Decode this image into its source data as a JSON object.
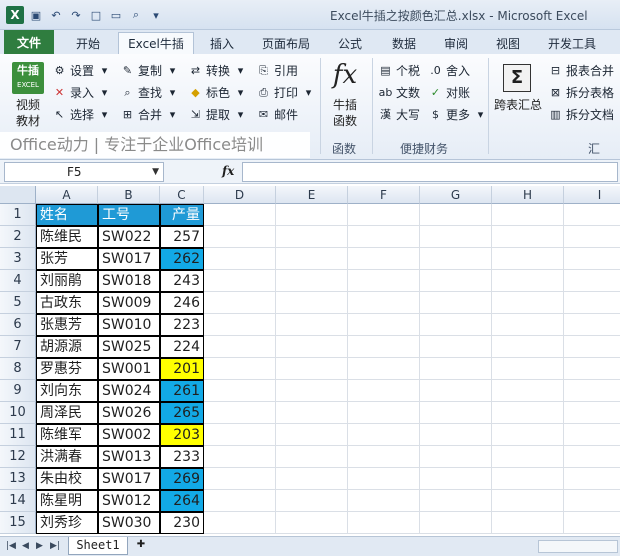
{
  "window": {
    "title": "Excel牛插之按颜色汇总.xlsx - Microsoft Excel",
    "app_icon": "X"
  },
  "qat": {
    "icons": [
      "save-icon",
      "undo-icon",
      "redo-icon",
      "new-icon",
      "open-icon",
      "print-preview-icon",
      "customize-icon"
    ]
  },
  "tabs": [
    "文件",
    "开始",
    "Excel牛插",
    "插入",
    "页面布局",
    "公式",
    "数据",
    "审阅",
    "视图",
    "开发工具"
  ],
  "ribbon": {
    "logo": {
      "line1": "牛插",
      "line2": "EXCEL"
    },
    "video_label_1": "视频",
    "video_label_2": "教材",
    "col1": [
      "设置",
      "录入",
      "选择"
    ],
    "col2": [
      "复制",
      "查找",
      "合并"
    ],
    "col3": [
      "转换",
      "标色",
      "提取"
    ],
    "col4": [
      "引用",
      "打印",
      "邮件"
    ],
    "func_label_1": "牛插",
    "func_label_2": "函数",
    "func_group": "函数",
    "finance": [
      "个税",
      "舍入",
      "文数",
      "对账",
      "大写",
      "更多"
    ],
    "finance_group": "便捷财务",
    "summary_big_1": "跨表汇总",
    "summary_items": [
      "报表合并",
      "拆分表格",
      "拆分文档"
    ],
    "summary_group": "汇总、"
  },
  "banner": "Office动力 | 专注于企业Office培训",
  "formula_bar": {
    "name_box": "F5",
    "fx": "fx",
    "content": ""
  },
  "columns": [
    "A",
    "B",
    "C",
    "D",
    "E",
    "F",
    "G",
    "H",
    "I"
  ],
  "rows": [
    "1",
    "2",
    "3",
    "4",
    "5",
    "6",
    "7",
    "8",
    "9",
    "10",
    "11",
    "12",
    "13",
    "14",
    "15"
  ],
  "table": {
    "headers": [
      "姓名",
      "工号",
      "产量"
    ],
    "records": [
      [
        "陈维民",
        "SW022",
        "257"
      ],
      [
        "张芳",
        "SW017",
        "262"
      ],
      [
        "刘丽鹃",
        "SW018",
        "243"
      ],
      [
        "古政东",
        "SW009",
        "246"
      ],
      [
        "张惠芳",
        "SW010",
        "223"
      ],
      [
        "胡源源",
        "SW025",
        "224"
      ],
      [
        "罗惠芬",
        "SW001",
        "201"
      ],
      [
        "刘向东",
        "SW024",
        "261"
      ],
      [
        "周泽民",
        "SW026",
        "265"
      ],
      [
        "陈维军",
        "SW002",
        "203"
      ],
      [
        "洪满春",
        "SW013",
        "233"
      ],
      [
        "朱由校",
        "SW017",
        "269"
      ],
      [
        "陈星明",
        "SW012",
        "264"
      ],
      [
        "刘秀珍",
        "SW030",
        "230"
      ]
    ],
    "highlight_colors": [
      "none",
      "blue",
      "none",
      "none",
      "none",
      "none",
      "yellow",
      "blue",
      "blue",
      "yellow",
      "none",
      "blue",
      "blue",
      "none"
    ],
    "header_color": "#1f9ad6",
    "blue_color": "#12a9e6",
    "yellow_color": "#ffff00"
  },
  "sheet_tabs": [
    "Sheet1"
  ]
}
